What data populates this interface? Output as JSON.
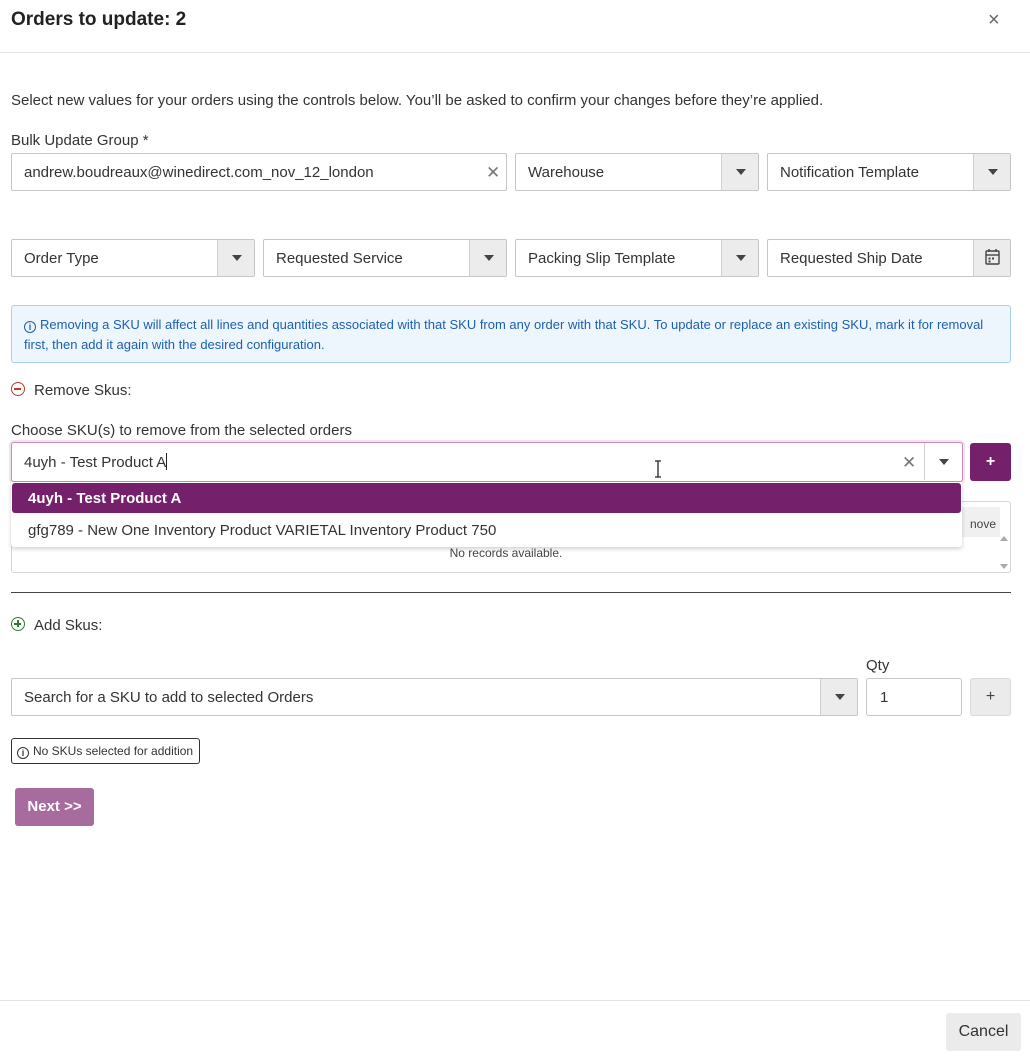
{
  "header": {
    "title": "Orders to update: 2",
    "close_glyph": "×"
  },
  "intro_text": "Select new values for your orders using the controls below. You’ll be asked to confirm your changes before they’re applied.",
  "bulk_group": {
    "label": "Bulk Update Group *",
    "value": "andrew.boudreaux@winedirect.com_nov_12_london"
  },
  "selects": {
    "warehouse": "Warehouse",
    "notification_template": "Notification Template",
    "order_type": "Order Type",
    "requested_service": "Requested Service",
    "packing_slip_template": "Packing Slip Template",
    "requested_ship_date": "Requested Ship Date"
  },
  "info_notice": "Removing a SKU will affect all lines and quantities associated with that SKU from any order with that SKU. To update or replace an existing SKU, mark it for removal first, then add it again with the desired configuration.",
  "remove_section": {
    "heading": "Remove Skus:",
    "choose_label": "Choose SKU(s) to remove from the selected orders",
    "search_value": "4uyh - Test Product A",
    "options": [
      "4uyh - Test Product A",
      "gfg789 - New One Inventory Product VARIETAL Inventory Product 750"
    ],
    "grid_header": "nove",
    "grid_empty": "No records available.",
    "add_button": "+"
  },
  "add_section": {
    "heading": "Add Skus:",
    "search_placeholder": "Search for a SKU to add to selected Orders",
    "qty_label": "Qty",
    "qty_value": "1",
    "add_button": "+",
    "none_selected": "No SKUs selected for addition"
  },
  "actions": {
    "next": "Next >>",
    "cancel": "Cancel"
  },
  "colors": {
    "brand_purple": "#74206a",
    "next_disabled": "#a86b9d",
    "info_blue": "#1d5fae"
  }
}
